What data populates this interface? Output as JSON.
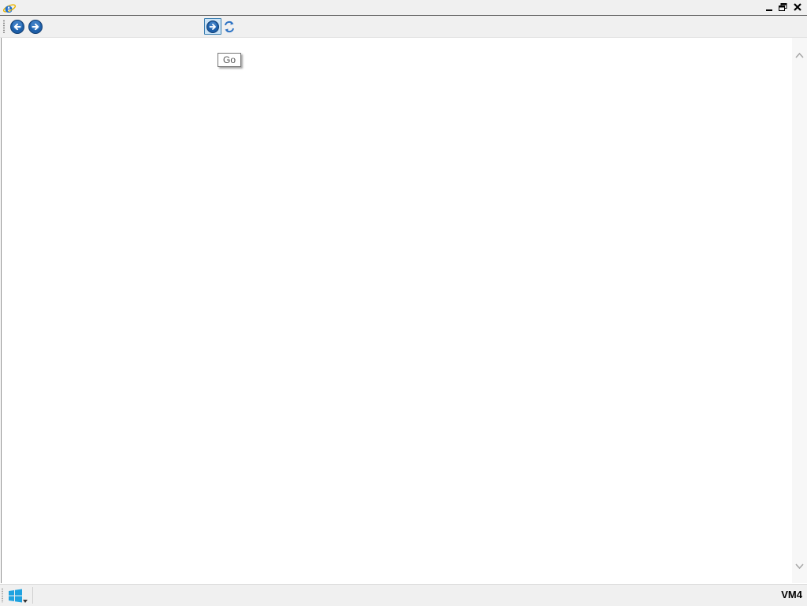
{
  "window": {
    "icon": "internet-explorer-icon",
    "controls": {
      "minimize_icon": "minimize-icon",
      "restore_icon": "restore-icon",
      "close_icon": "close-icon"
    }
  },
  "toolbar": {
    "back_icon": "back-arrow-icon",
    "forward_icon": "forward-arrow-icon",
    "address_value": "",
    "address_placeholder": "",
    "go_icon": "go-arrow-icon",
    "refresh_icon": "refresh-icon"
  },
  "tooltip": {
    "text": "Go"
  },
  "taskbar": {
    "start_icon": "windows-logo-icon",
    "machine_label": "VM4"
  },
  "colors": {
    "accent": "#1e5fa8",
    "go_highlight": "#cce4f7",
    "chrome_bg": "#f0f0f0"
  }
}
